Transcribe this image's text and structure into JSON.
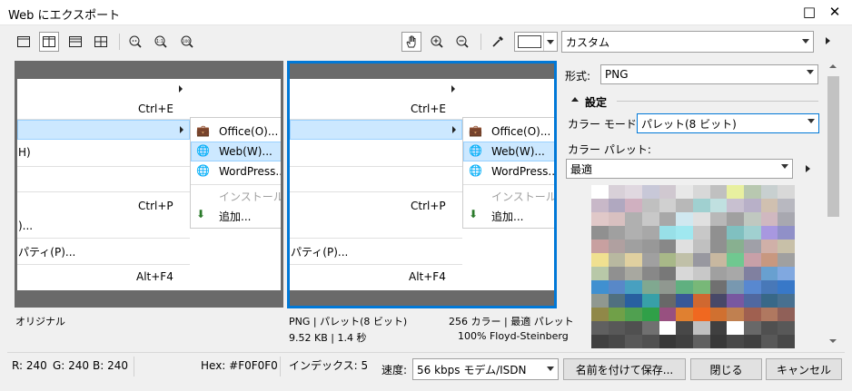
{
  "window": {
    "title": "Web にエクスポート",
    "maximize_icon": "□",
    "close_icon": "✕"
  },
  "toolbar": {
    "preset": "カスタム"
  },
  "left_pane": {
    "menu": [
      {
        "text": "",
        "shortcut": ""
      },
      {
        "text": "",
        "shortcut": "Ctrl+E"
      },
      {
        "text": "",
        "shortcut": ""
      },
      {
        "text": "H)",
        "shortcut": ""
      },
      {
        "text": "",
        "shortcut": ""
      },
      {
        "text": "",
        "shortcut": "Ctrl+P"
      },
      {
        "text": ")...",
        "shortcut": ""
      },
      {
        "text": "パティ(P)...",
        "shortcut": ""
      },
      {
        "text": "",
        "shortcut": "Alt+F4"
      }
    ],
    "submenu": [
      "Office(O)...",
      "Web(W)...",
      "WordPress...",
      "インストールさ",
      "追加..."
    ],
    "label": "オリジナル"
  },
  "right_pane": {
    "menu": [
      {
        "text": "",
        "shortcut": ""
      },
      {
        "text": "",
        "shortcut": "Ctrl+E"
      },
      {
        "text": "",
        "shortcut": ""
      },
      {
        "text": "",
        "shortcut": ""
      },
      {
        "text": "",
        "shortcut": ""
      },
      {
        "text": "",
        "shortcut": "Ctrl+P"
      },
      {
        "text": "",
        "shortcut": ""
      },
      {
        "text": "パティ(P)...",
        "shortcut": ""
      },
      {
        "text": "",
        "shortcut": "Alt+F4"
      }
    ],
    "submenu": [
      "Office(O)...",
      "Web(W)...",
      "WordPress...",
      "インストールさ",
      "追加..."
    ],
    "info_line1": "PNG  |  パレット(8 ビット)",
    "info_line1_right": "256 カラー  |  最適 パレット",
    "info_line2": "9.52 KB  |  1.4 秒",
    "info_line2_right": "100% Floyd-Steinberg"
  },
  "settings": {
    "format_label": "形式:",
    "format_value": "PNG",
    "section_label": "設定",
    "color_mode_label": "カラー モード:",
    "color_mode_value": "パレット(8 ビット)",
    "color_palette_label": "カラー パレット:",
    "palette_value": "最適"
  },
  "palette_colors": [
    "#ffffff",
    "#d8d0d8",
    "#e0d8e0",
    "#c8c8d8",
    "#d0c8d0",
    "#e8e8e8",
    "#d8d8d8",
    "#c0c0c0",
    "#e8f0a0",
    "#b8c8b0",
    "#c8d0d0",
    "#d8d8d8",
    "#c8b8c8",
    "#b0a8c0",
    "#d0b0c0",
    "#c0c0c0",
    "#d0d0d0",
    "#b8b8b8",
    "#a0d0d0",
    "#c0e0e0",
    "#c8c0d0",
    "#b8b0c8",
    "#d0c0b0",
    "#b8b8c0",
    "#e0c8c8",
    "#d8c0c0",
    "#b0b0b0",
    "#c8c8c8",
    "#a8a8a8",
    "#d0e8f0",
    "#e0e0e0",
    "#b8b8b8",
    "#a0a0a0",
    "#c0c8c0",
    "#d0b8c0",
    "#a8a8b0",
    "#909090",
    "#a0a0a0",
    "#b0b0b0",
    "#a8a8a8",
    "#98e0e8",
    "#a0e8f0",
    "#c8c8c8",
    "#909090",
    "#80c0c0",
    "#a0d0d0",
    "#a898e0",
    "#9090c8",
    "#c8a0a0",
    "#b0a0a0",
    "#a0a0a0",
    "#989898",
    "#888888",
    "#e0e0e0",
    "#c0c0c0",
    "#909090",
    "#88b090",
    "#a0a0a8",
    "#d0b0a8",
    "#c8c0a8",
    "#f0e090",
    "#b8b8a0",
    "#e0d0a0",
    "#a0a0a0",
    "#a8b888",
    "#c0c0a8",
    "#9898a0",
    "#c8b8a0",
    "#70c890",
    "#c8a0a8",
    "#c89880",
    "#a0a0a0",
    "#b8c8a8",
    "#909090",
    "#a8a8a0",
    "#888888",
    "#787878",
    "#d8d8d8",
    "#c8c8c8",
    "#a0a0a0",
    "#a8a8a8",
    "#8080a0",
    "#68a0d0",
    "#80a8e0",
    "#4090d0",
    "#5888c8",
    "#48a0c0",
    "#80a890",
    "#909890",
    "#60b080",
    "#78b878",
    "#707070",
    "#7898b0",
    "#5888d0",
    "#4878b8",
    "#3878c8",
    "#909890",
    "#507080",
    "#2860a0",
    "#38a0a8",
    "#686868",
    "#385898",
    "#d06830",
    "#484868",
    "#7858a0",
    "#5068a0",
    "#386888",
    "#487090",
    "#908848",
    "#70a048",
    "#50a050",
    "#30a048",
    "#985080",
    "#e08030",
    "#f06820",
    "#d07030",
    "#c08050",
    "#a06050",
    "#b07860",
    "#906058",
    "#606060",
    "#585858",
    "#505050",
    "#707070",
    "#ffffff",
    "#484848",
    "#c0c0c0",
    "#404040",
    "#ffffff",
    "#686868",
    "#505050",
    "#585858",
    "#404040",
    "#484848",
    "#585858",
    "#505050",
    "#383838",
    "#404040",
    "#606060",
    "#383838",
    "#484848",
    "#404040",
    "#585858",
    "#484848"
  ],
  "status": {
    "r": "R: 240",
    "g": "G: 240",
    "b": "B: 240",
    "hex": "Hex: #F0F0F0",
    "index": "インデックス: 5",
    "speed_label": "速度:",
    "speed_value": "56 kbps モデム/ISDN"
  },
  "buttons": {
    "save": "名前を付けて保存...",
    "close": "閉じる",
    "cancel": "キャンセル"
  }
}
